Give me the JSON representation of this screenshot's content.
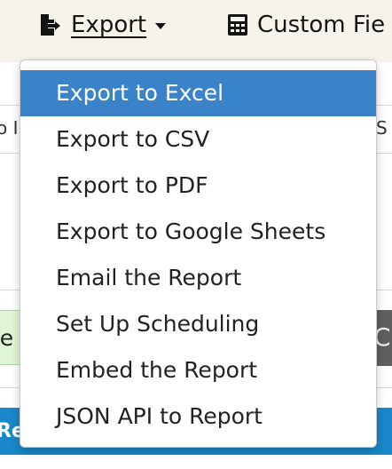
{
  "toolbar": {
    "export_label": "Export",
    "export_icon": "file-export-icon",
    "custom_fields_label": "Custom Fie",
    "custom_fields_icon": "calculator-icon"
  },
  "background": {
    "row1_left_text": "o I",
    "row1_right_text": "S V",
    "green_button_text": "te",
    "gray_button_text": "Ch",
    "blue_bar_text": "Re"
  },
  "colors": {
    "toolbar_bg": "#f6f3ea",
    "menu_highlight": "#3b83c8",
    "blue_bar": "#1a87c8",
    "green_button": "#dff5d6",
    "gray_button": "#5f5f5f"
  },
  "export_menu": {
    "items": [
      {
        "label": "Export to Excel",
        "active": true
      },
      {
        "label": "Export to CSV"
      },
      {
        "label": "Export to PDF"
      },
      {
        "label": "Export to Google Sheets"
      },
      {
        "label": "Email the Report"
      },
      {
        "label": "Set Up Scheduling"
      },
      {
        "label": "Embed the Report"
      },
      {
        "label": "JSON API to Report"
      }
    ]
  }
}
